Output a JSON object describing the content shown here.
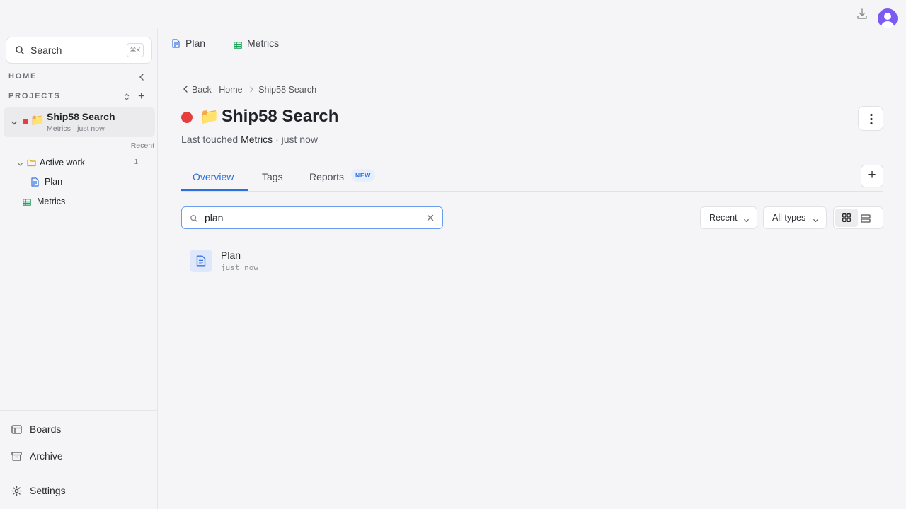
{
  "sidebar": {
    "search_label": "Search",
    "search_shortcut": "⌘K",
    "home_label": "HOME",
    "projects_label": "PROJECTS",
    "project": {
      "name": "Ship58 Search",
      "emoji": "📁",
      "subtitle": "Metrics · just now",
      "status_color": "#e53e3e"
    },
    "recent_label": "Recent",
    "tree": {
      "folder_label": "Active work",
      "folder_count": "1",
      "plan_label": "Plan",
      "metrics_label": "Metrics"
    },
    "footer": {
      "boards": "Boards",
      "archive": "Archive",
      "settings": "Settings"
    }
  },
  "file_tabs": [
    {
      "label": "Plan",
      "icon": "document-icon"
    },
    {
      "label": "Metrics",
      "icon": "spreadsheet-icon"
    }
  ],
  "breadcrumb": {
    "back": "Back",
    "home": "Home",
    "current": "Ship58 Search"
  },
  "header": {
    "emoji": "📁",
    "title": "Ship58 Search",
    "touched_prefix": "Last touched",
    "touched_item": "Metrics",
    "touched_suffix": "· just now"
  },
  "content_tabs": {
    "overview": "Overview",
    "tags": "Tags",
    "reports": "Reports",
    "reports_badge": "NEW"
  },
  "filter": {
    "value": "plan"
  },
  "dropdowns": {
    "sort": "Recent",
    "type": "All types"
  },
  "results": [
    {
      "name": "Plan",
      "time": "just now"
    }
  ],
  "colors": {
    "accent": "#2a6fdb",
    "avatar": "#7c5cf0",
    "status": "#e53e3e"
  }
}
